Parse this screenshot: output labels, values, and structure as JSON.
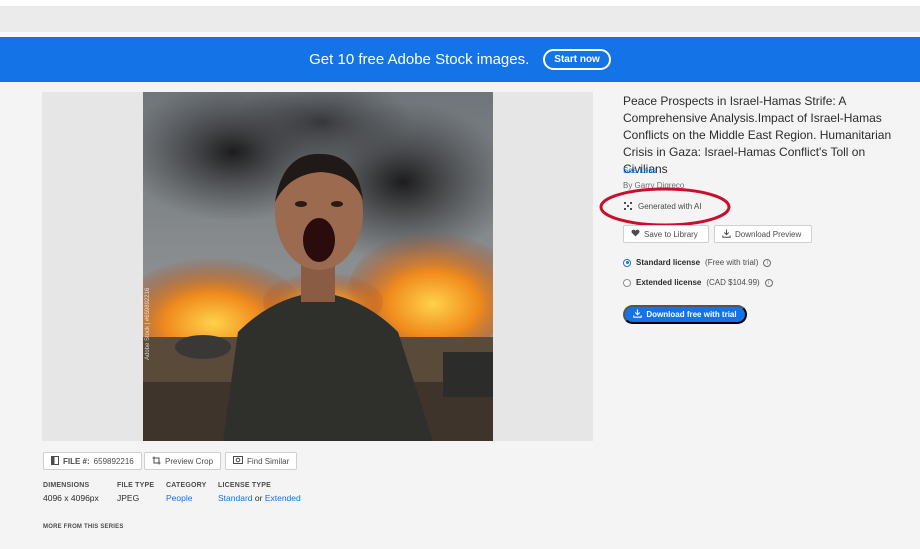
{
  "promo": {
    "text": "Get 10 free Adobe Stock images.",
    "button_label": "Start now"
  },
  "asset": {
    "title": "Peace Prospects in Israel-Hamas Strife: A Comprehensive Analysis.Impact of Israel-Hamas Conflicts on the Middle East Region. Humanitarian Crisis in Gaza: Israel-Hamas Conflict's Toll on Civilians",
    "see_less": "See Less",
    "by_line": "By Garry Digreco",
    "ai_badge": "Generated with AI",
    "watermark": "Adobe Stock | #659892216"
  },
  "actions": {
    "save_label": "Save to Library",
    "download_preview_label": "Download Preview",
    "cta_label": "Download free with trial"
  },
  "licenses": {
    "standard": {
      "name": "Standard license",
      "note": "(Free with trial)"
    },
    "extended": {
      "name": "Extended license",
      "note": "(CAD $104.99)"
    },
    "info_icon": "i"
  },
  "toolbar": {
    "file_label": "FILE #:",
    "file_number": "659892216",
    "preview_crop": "Preview Crop",
    "find_similar": "Find Similar"
  },
  "details": {
    "dimensions_head": "DIMENSIONS",
    "dimensions_val": "4096 x 4096px",
    "filetype_head": "FILE TYPE",
    "filetype_val": "JPEG",
    "category_head": "CATEGORY",
    "category_val": "People",
    "license_head": "LICENSE TYPE",
    "license_standard": "Standard",
    "license_or": "or",
    "license_extended": "Extended"
  },
  "more_series": "MORE FROM THIS SERIES",
  "colors": {
    "accent": "#1473e6",
    "annotation": "#c8102e"
  },
  "icons": [
    "heart-icon",
    "download-icon",
    "crop-icon",
    "find-similar-icon",
    "file-icon",
    "ai-sparkle-icon",
    "info-icon"
  ]
}
